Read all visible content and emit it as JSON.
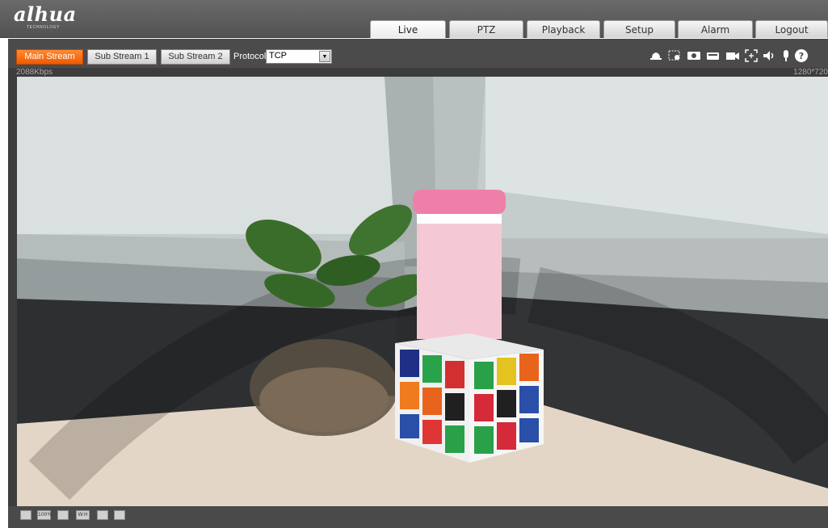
{
  "header": {
    "logo": "alhua",
    "logo_sub": "TECHNOLOGY",
    "tabs": [
      {
        "label": "Live",
        "active": true
      },
      {
        "label": "PTZ",
        "active": false
      },
      {
        "label": "Playback",
        "active": false
      },
      {
        "label": "Setup",
        "active": false
      },
      {
        "label": "Alarm",
        "active": false
      },
      {
        "label": "Logout",
        "active": false
      }
    ]
  },
  "toolbar": {
    "streams": [
      {
        "label": "Main Stream",
        "active": true
      },
      {
        "label": "Sub Stream 1",
        "active": false
      },
      {
        "label": "Sub Stream 2",
        "active": false
      }
    ],
    "protocol_label": "Protocol",
    "protocol_value": "TCP",
    "bitrate": "2088Kbps",
    "resolution": "1280*720",
    "icons": [
      "bell-icon",
      "region-zoom-icon",
      "record-icon",
      "snapshot-icon",
      "video-camera-icon",
      "fullscreen-icon",
      "speaker-icon",
      "microphone-icon",
      "help-icon"
    ]
  },
  "bottom_bar": {
    "buttons": [
      {
        "icon": "image-adjust-icon",
        "label": ""
      },
      {
        "icon": "original-size-icon",
        "label": "100%"
      },
      {
        "icon": "fit-window-icon",
        "label": ""
      },
      {
        "icon": "width-height-icon",
        "label": "W:H"
      },
      {
        "icon": "full-view-icon",
        "label": ""
      },
      {
        "icon": "expand-icon",
        "label": ""
      }
    ]
  },
  "colors": {
    "accent": "#f26a10",
    "header_bg": "#5e5e5e",
    "toolbar_bg": "#4b4b4b"
  }
}
